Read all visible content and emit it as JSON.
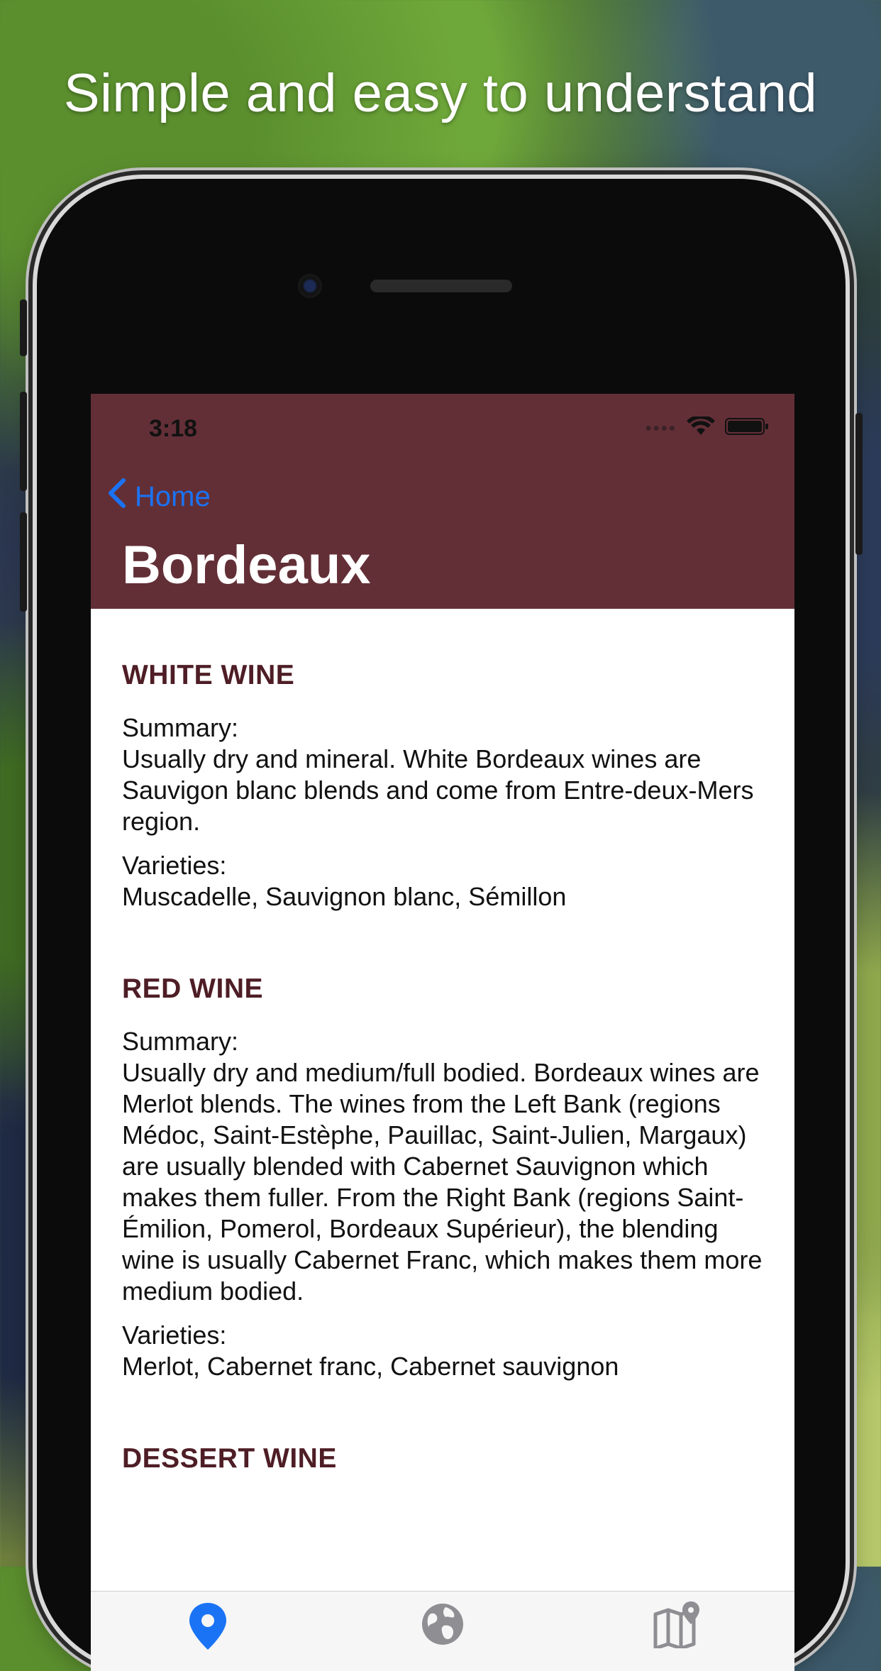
{
  "headline": "Simple and easy to understand",
  "status": {
    "time": "3:18"
  },
  "nav": {
    "back_label": "Home",
    "title": "Bordeaux"
  },
  "sections": [
    {
      "title": "WHITE WINE",
      "summary_label": "Summary:",
      "summary": "Usually dry and mineral. White Bordeaux wines are Sauvigon blanc blends and come from Entre-deux-Mers region.",
      "varieties_label": "Varieties:",
      "varieties": "Muscadelle, Sauvignon blanc, Sémillon"
    },
    {
      "title": "RED WINE",
      "summary_label": "Summary:",
      "summary": "Usually dry and medium/full bodied. Bordeaux wines are Merlot blends. The wines from the Left Bank (regions Médoc, Saint-Estèphe, Pauillac, Saint-Julien, Margaux) are usually blended with Cabernet Sauvignon which makes them fuller. From the Right Bank (regions Saint-Émilion, Pomerol, Bordeaux Supérieur), the blending wine is usually Cabernet Franc, which makes them more medium bodied.",
      "varieties_label": "Varieties:",
      "varieties": "Merlot, Cabernet franc, Cabernet sauvignon"
    },
    {
      "title": "DESSERT WINE"
    }
  ],
  "tabs": [
    {
      "icon": "map-pin-icon",
      "active": true
    },
    {
      "icon": "globe-icon",
      "active": false
    },
    {
      "icon": "map-icon",
      "active": false
    }
  ],
  "colors": {
    "nav_bg": "#632f37",
    "section_title": "#4e1d25",
    "link_blue": "#1a73f5",
    "tab_active": "#1a73f5",
    "tab_inactive": "#8e8e93"
  }
}
